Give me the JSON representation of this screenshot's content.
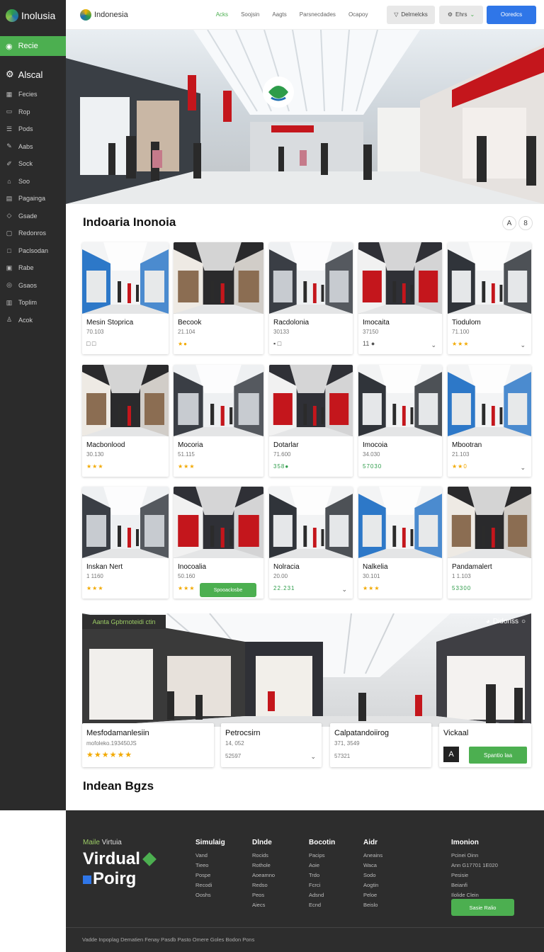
{
  "sidebar": {
    "brand": "Inolusia",
    "active_item": "Recie",
    "section": "Alscal",
    "items": [
      {
        "label": "Fecies",
        "icon": "grid-icon"
      },
      {
        "label": "Rop",
        "icon": "folder-icon"
      },
      {
        "label": "Pods",
        "icon": "list-icon"
      },
      {
        "label": "Aabs",
        "icon": "pen-icon"
      },
      {
        "label": "Sock",
        "icon": "edit-icon"
      },
      {
        "label": "Soo",
        "icon": "tag-icon"
      },
      {
        "label": "Pagainga",
        "icon": "chart-icon"
      },
      {
        "label": "Gsade",
        "icon": "cube-icon"
      },
      {
        "label": "Redonros",
        "icon": "box-icon"
      },
      {
        "label": "Paclsodan",
        "icon": "square-icon"
      },
      {
        "label": "Rabe",
        "icon": "image-icon"
      },
      {
        "label": "Gsaos",
        "icon": "circle-icon"
      },
      {
        "label": "Toplim",
        "icon": "note-icon"
      },
      {
        "label": "Acok",
        "icon": "user-icon"
      }
    ]
  },
  "topbar": {
    "brand": "Indonesia",
    "links": [
      "Acks",
      "Soojsin",
      "Aagts",
      "Parsnecdades",
      "Ocapoy"
    ],
    "btn1": "Delrnelcks",
    "btn2": "Ehrs",
    "btn3": "Ooredcs"
  },
  "section1": {
    "title": "Indoaria Inonoia",
    "btn_a": "A",
    "btn_b": "8"
  },
  "cards": [
    {
      "name": "Mesin Stoprica",
      "sub": "70.103",
      "meta": "□ □"
    },
    {
      "name": "Becook",
      "sub": "21.104",
      "meta": "★●"
    },
    {
      "name": "Racdolonia",
      "sub": "30133",
      "meta": "▪ □"
    },
    {
      "name": "Imocaita",
      "sub": "37150",
      "meta": "11 ●"
    },
    {
      "name": "Tiodulom",
      "sub": "71.100",
      "meta": "★★★"
    },
    {
      "name": "Macbonlood",
      "sub": "30.130",
      "meta": "★★★"
    },
    {
      "name": "Mocoria",
      "sub": "51.115",
      "meta": "★★★"
    },
    {
      "name": "Dotarlar",
      "sub": "71.600",
      "meta": "358●"
    },
    {
      "name": "Imocoia",
      "sub": "34.030",
      "meta": "57030"
    },
    {
      "name": "Mbootran",
      "sub": "21.103",
      "meta": "★★0"
    },
    {
      "name": "Inskan Nert",
      "sub": "1 1160",
      "meta": "★★★"
    },
    {
      "name": "Inocoalia",
      "sub": "50.160",
      "meta": "★★★"
    },
    {
      "name": "Nolracia",
      "sub": "20.00",
      "meta": "22.231"
    },
    {
      "name": "Nalkelia",
      "sub": "30.101",
      "meta": "★★★"
    },
    {
      "name": "Pandamalert",
      "sub": "1 1.103",
      "meta": "53300"
    }
  ],
  "card_button": "Spooaclosbe",
  "banner": {
    "tag": "Aanta Gpbrnoteidi ctin",
    "logo": "Didonss",
    "cards": [
      {
        "title": "Mesfodamanlesiin",
        "sub": "mofoleko.193450JS",
        "stars": "★★★★★★"
      },
      {
        "title": "Petrocsirn",
        "sub": "14, 052",
        "sub2": "52597"
      },
      {
        "title": "Calpatandoiirog",
        "sub": "371, 3549",
        "sub2": "57321"
      },
      {
        "title": "Vickaal",
        "button": "Spantio laa",
        "badge": "A"
      }
    ]
  },
  "section2": {
    "title": "Indean Bgzs"
  },
  "footer": {
    "brand_pre_accent": "Maile",
    "brand_pre": "Virtuia",
    "brand_line1": "Virdual",
    "brand_line2": "Poirg",
    "columns": [
      {
        "title": "Simulaig",
        "items": [
          "Vand",
          "Tieeo",
          "Pospe",
          "Recodi",
          "Ooshs"
        ]
      },
      {
        "title": "Dlnde",
        "items": [
          "Rocids",
          "Rothole",
          "Aoeamno",
          "Redso",
          "Peos",
          "Aiecs"
        ]
      },
      {
        "title": "Bocotin",
        "items": [
          "Pacips",
          "Aoie",
          "Trdo",
          "Fcrci",
          "Adsnd",
          "Ecnd"
        ]
      },
      {
        "title": "Aidr",
        "items": [
          "Aneains",
          "Waca",
          "Sodo",
          "Aogtin",
          "Peloe",
          "Beislo"
        ]
      },
      {
        "title": "Imonion",
        "items": [
          "Pcinei Oinn",
          "Ann G17701 1E020",
          "Pesisie",
          "Beianfi",
          "Ilolide Clein"
        ]
      }
    ],
    "button": "Sasie Ralio",
    "bottom": "Vadde Inpoplag Dematien Fenay Pasdb Pasto Omere Goles Bodon Pons"
  },
  "colors": {
    "accent": "#4caf50",
    "primary": "#2f76e8",
    "sidebar": "#2b2b2b",
    "footer": "#2d2d2d",
    "star": "#f2a900"
  }
}
